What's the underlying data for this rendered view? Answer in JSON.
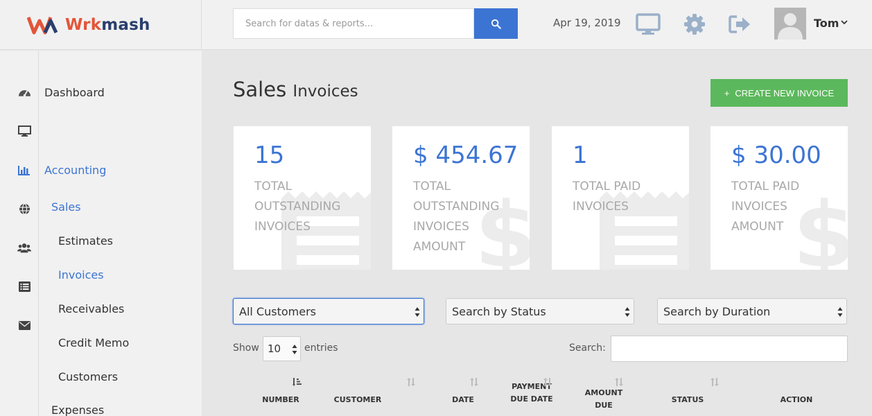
{
  "brand": {
    "name_a": "Wrk",
    "name_b": "mash",
    "colors": {
      "primary": "#3c74d3",
      "logo_orange": "#e2553a",
      "logo_navy": "#2a3f6d",
      "success": "#5cb85c"
    }
  },
  "search": {
    "placeholder": "Search for datas & reports..."
  },
  "header": {
    "date": "Apr 19, 2019",
    "user_name": "Tom",
    "icons": [
      "monitor-icon",
      "gear-icon",
      "sign-out-icon"
    ]
  },
  "sidebar": {
    "icons": [
      "dashboard-icon",
      "desktop-icon",
      "bar-chart-icon",
      "globe-icon",
      "users-icon",
      "list-icon",
      "envelope-icon"
    ],
    "items": [
      {
        "label": "Dashboard"
      },
      {
        "label": "Accounting"
      },
      {
        "label": "Sales"
      },
      {
        "label": "Estimates"
      },
      {
        "label": "Invoices"
      },
      {
        "label": "Receivables"
      },
      {
        "label": "Credit Memo"
      },
      {
        "label": "Customers"
      },
      {
        "label": "Expenses"
      }
    ]
  },
  "page": {
    "title": "Sales",
    "subtitle": "Invoices",
    "create_button": "CREATE NEW INVOICE",
    "create_icon": "+"
  },
  "cards": [
    {
      "value": "15",
      "label": "TOTAL OUTSTANDING INVOICES",
      "icon": "receipt-icon"
    },
    {
      "value": "$ 454.67",
      "label": "TOTAL OUTSTANDING INVOICES AMOUNT",
      "icon": "dollar-icon"
    },
    {
      "value": "1",
      "label": "TOTAL PAID INVOICES",
      "icon": "receipt-icon"
    },
    {
      "value": "$ 30.00",
      "label": "TOTAL PAID INVOICES AMOUNT",
      "icon": "dollar-icon"
    }
  ],
  "filters": {
    "customers": "All Customers",
    "status": "Search by Status",
    "duration": "Search by Duration"
  },
  "table": {
    "show_label": "Show",
    "page_length": "10",
    "entries_label": "entries",
    "search_label": "Search:",
    "columns": [
      "NUMBER",
      "CUSTOMER",
      "DATE",
      "PAYMENT DUE DATE",
      "AMOUNT DUE",
      "STATUS",
      "ACTION"
    ]
  }
}
